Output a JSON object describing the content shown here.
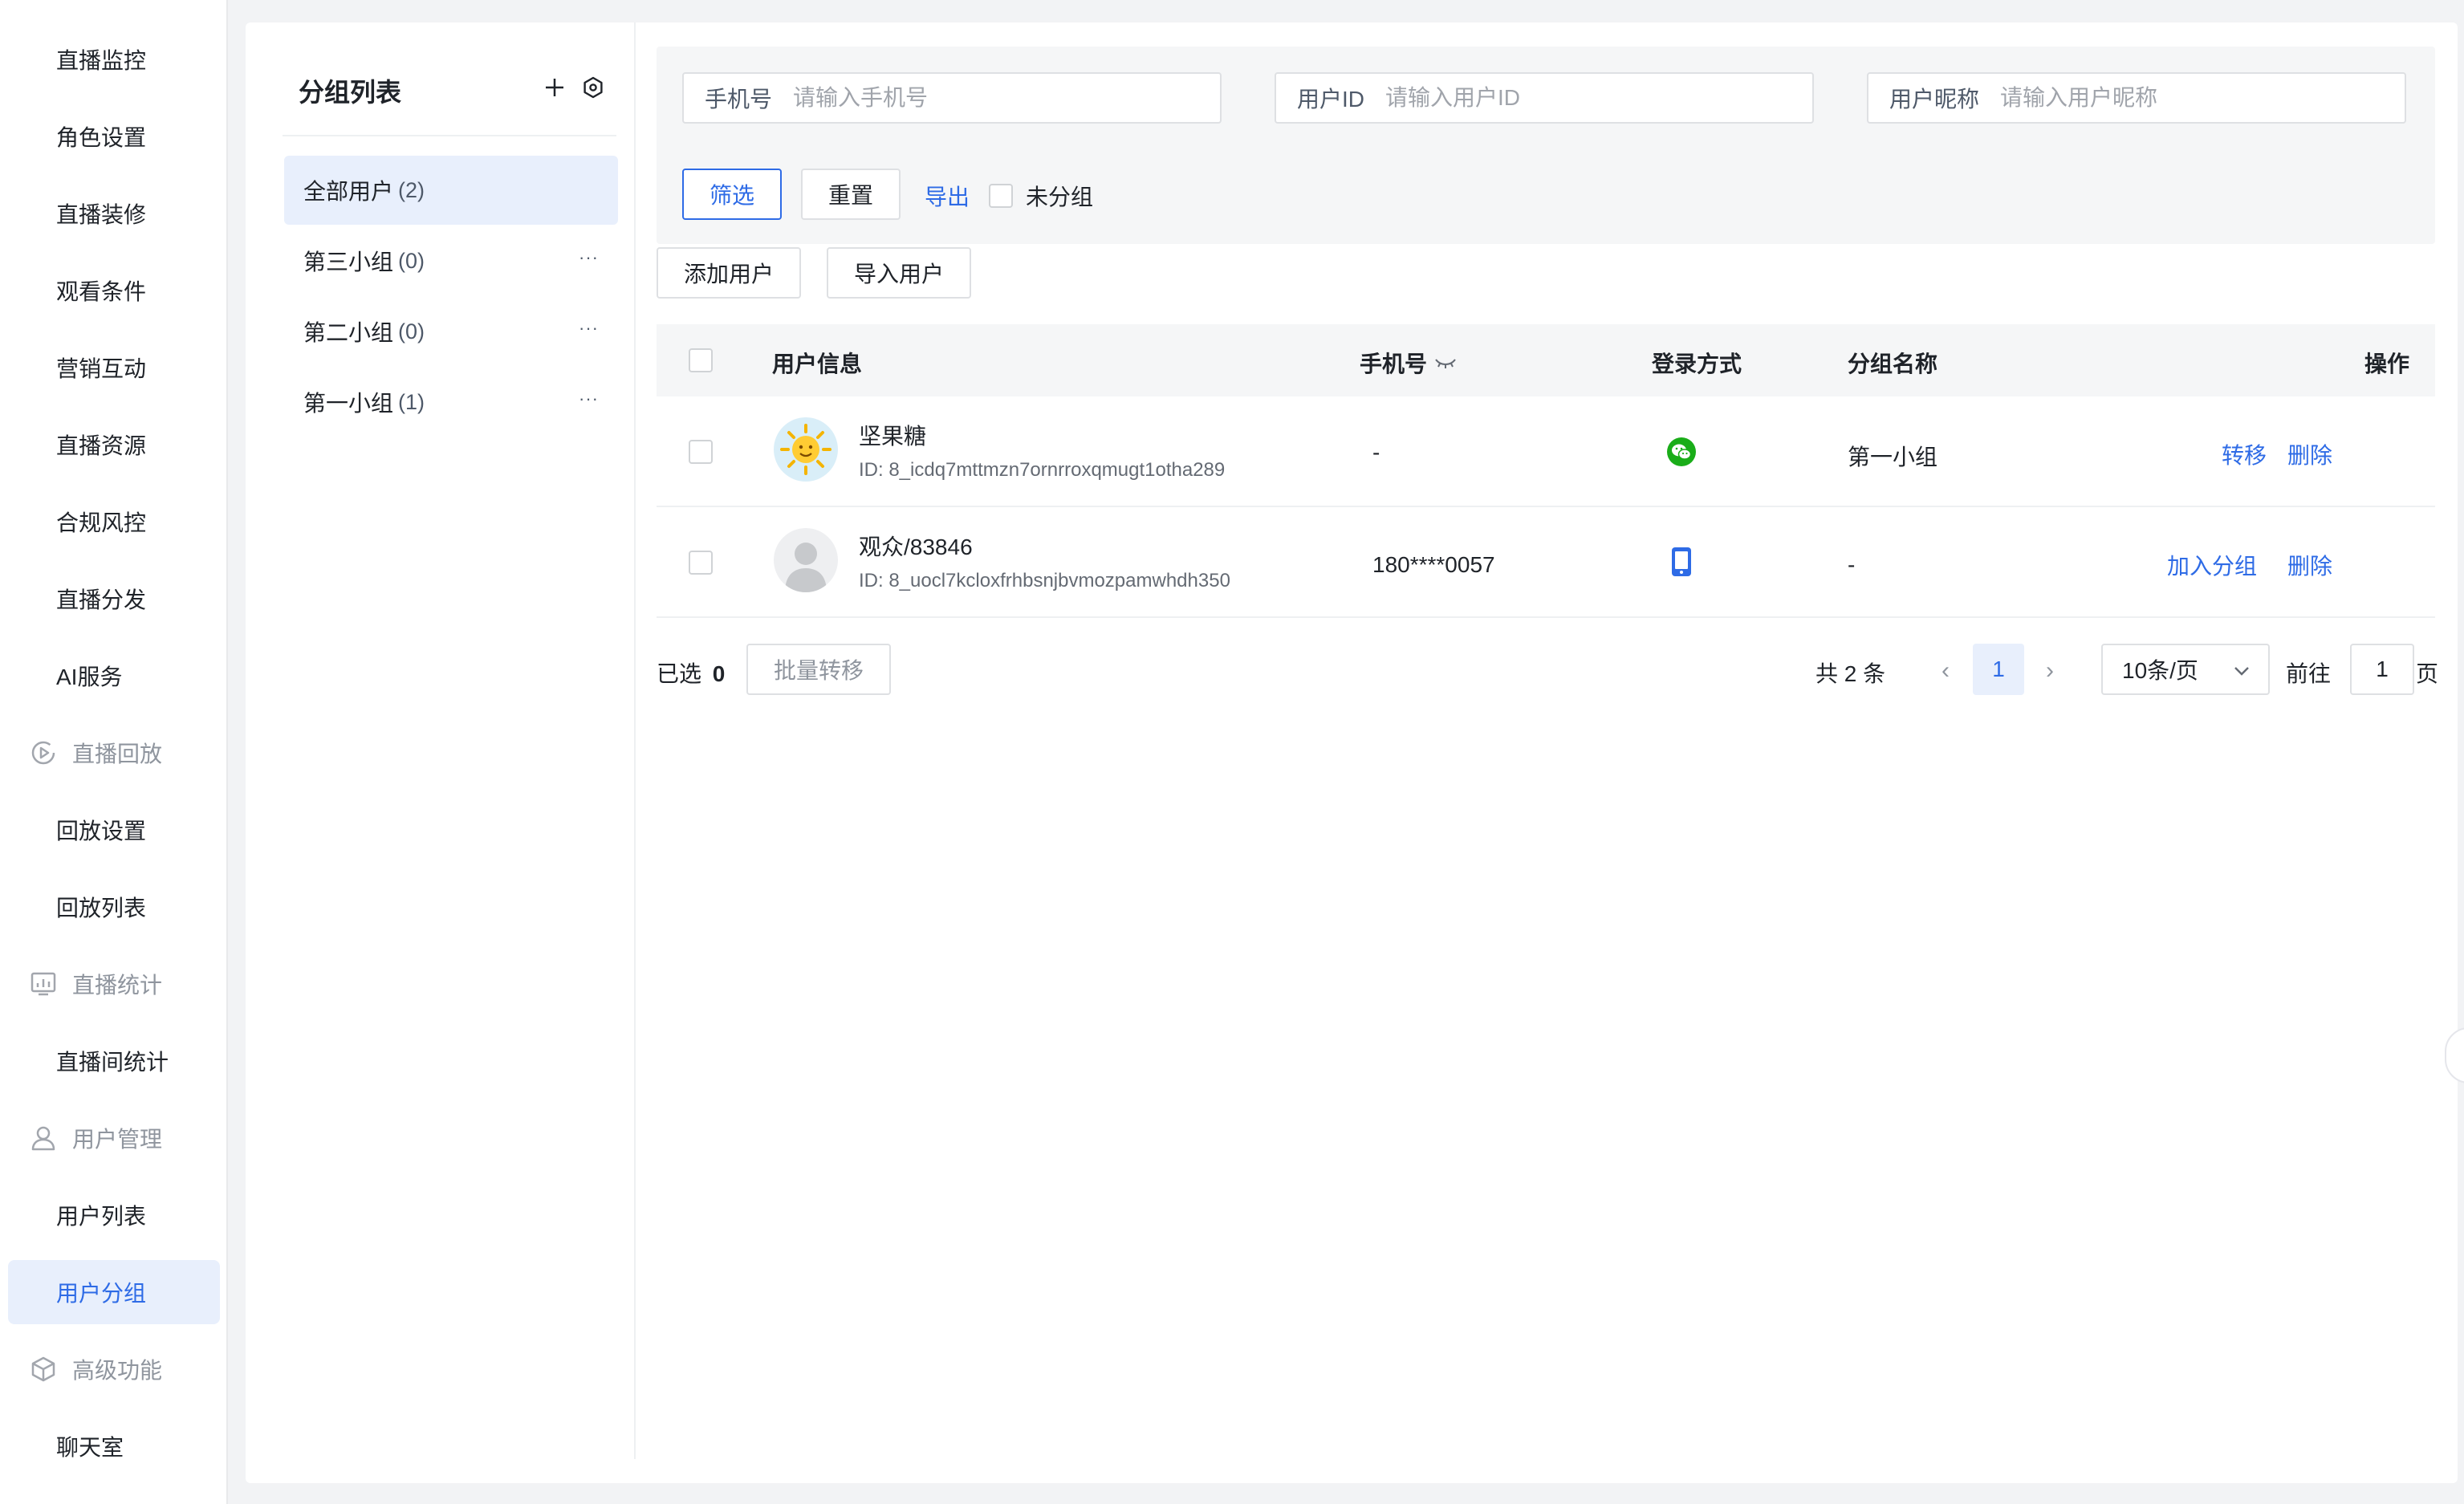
{
  "sidebar": {
    "items": [
      {
        "label": "直播监控"
      },
      {
        "label": "角色设置"
      },
      {
        "label": "直播装修"
      },
      {
        "label": "观看条件"
      },
      {
        "label": "营销互动"
      },
      {
        "label": "直播资源"
      },
      {
        "label": "合规风控"
      },
      {
        "label": "直播分发"
      },
      {
        "label": "AI服务"
      }
    ],
    "group_replay": {
      "label": "直播回放",
      "icon": "replay-icon"
    },
    "replay_items": [
      {
        "label": "回放设置"
      },
      {
        "label": "回放列表"
      }
    ],
    "group_stats": {
      "label": "直播统计",
      "icon": "chart-icon"
    },
    "stats_items": [
      {
        "label": "直播间统计"
      }
    ],
    "group_users": {
      "label": "用户管理",
      "icon": "user-icon"
    },
    "user_items": [
      {
        "label": "用户列表"
      },
      {
        "label": "用户分组",
        "active": true
      }
    ],
    "group_advanced": {
      "label": "高级功能",
      "icon": "cube-icon"
    },
    "advanced_items": [
      {
        "label": "聊天室"
      }
    ]
  },
  "group_panel": {
    "title": "分组列表",
    "groups": [
      {
        "name": "全部用户",
        "count": "(2)",
        "active": true
      },
      {
        "name": "第三小组",
        "count": "(0)",
        "more": "···"
      },
      {
        "name": "第二小组",
        "count": "(0)",
        "more": "···"
      },
      {
        "name": "第一小组",
        "count": "(1)",
        "more": "···"
      }
    ]
  },
  "filter": {
    "phone": {
      "label": "手机号",
      "placeholder": "请输入手机号"
    },
    "user_id": {
      "label": "用户ID",
      "placeholder": "请输入用户ID"
    },
    "nickname": {
      "label": "用户昵称",
      "placeholder": "请输入用户昵称"
    },
    "filter_btn": "筛选",
    "reset_btn": "重置",
    "export_link": "导出",
    "ungrouped_label": "未分组"
  },
  "actions": {
    "add_user": "添加用户",
    "import_user": "导入用户"
  },
  "table": {
    "columns": {
      "user_info": "用户信息",
      "phone": "手机号",
      "login": "登录方式",
      "group_name": "分组名称",
      "operation": "操作"
    },
    "rows": [
      {
        "name": "坚果糖",
        "id": "ID: 8_icdq7mttmzn7ornrroxqmugt1otha289",
        "phone": "-",
        "login_icon": "wechat-icon",
        "group": "第一小组",
        "ops": [
          "转移",
          "删除"
        ]
      },
      {
        "name": "观众/83846",
        "id": "ID: 8_uocl7kcloxfrhbsnjbvmozpamwhdh350",
        "phone": "180****0057",
        "login_icon": "mobile-icon",
        "group": "-",
        "ops": [
          "加入分组",
          "删除"
        ]
      }
    ]
  },
  "footer": {
    "selected_label": "已选",
    "selected_count": "0",
    "batch_btn": "批量转移",
    "total": "共 2 条",
    "prev": "‹",
    "current_page": "1",
    "next": "›",
    "page_size": "10条/页",
    "goto_label": "前往",
    "goto_value": "1",
    "page_suffix": "页"
  },
  "colors": {
    "accent": "#2e6be6",
    "wechat": "#1aad19",
    "active_bg": "#e8effc"
  }
}
